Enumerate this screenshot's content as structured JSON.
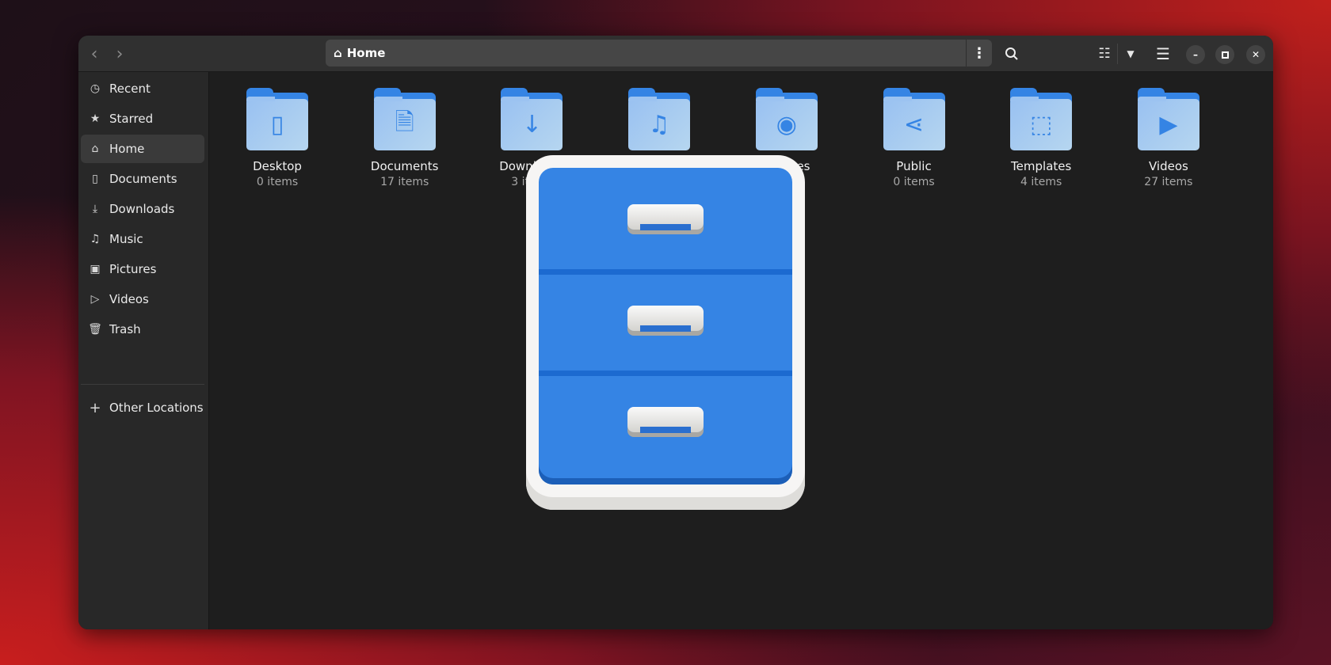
{
  "header": {
    "path": "Home",
    "back_icon": "chevron-left",
    "forward_icon": "chevron-right"
  },
  "sidebar": {
    "items": [
      {
        "label": "Recent",
        "icon": "◷"
      },
      {
        "label": "Starred",
        "icon": "★"
      },
      {
        "label": "Home",
        "icon": "⌂"
      },
      {
        "label": "Documents",
        "icon": "▯"
      },
      {
        "label": "Downloads",
        "icon": "⤓"
      },
      {
        "label": "Music",
        "icon": "♫"
      },
      {
        "label": "Pictures",
        "icon": "▣"
      },
      {
        "label": "Videos",
        "icon": "▷"
      },
      {
        "label": "Trash",
        "icon": "🗑"
      }
    ],
    "other": {
      "label": "Other Locations",
      "icon": "+"
    }
  },
  "folders": [
    {
      "name": "Desktop",
      "count": "0 items",
      "icon": "▯"
    },
    {
      "name": "Documents",
      "count": "17 items",
      "icon": "🗎"
    },
    {
      "name": "Downloads",
      "count": "3 items",
      "icon": "↓"
    },
    {
      "name": "Music",
      "count": "",
      "icon": "♫"
    },
    {
      "name": "Pictures",
      "count": "",
      "icon": "◉"
    },
    {
      "name": "Public",
      "count": "0 items",
      "icon": "⋖"
    },
    {
      "name": "Templates",
      "count": "4 items",
      "icon": "⬚"
    },
    {
      "name": "Videos",
      "count": "27 items",
      "icon": "▶"
    }
  ]
}
